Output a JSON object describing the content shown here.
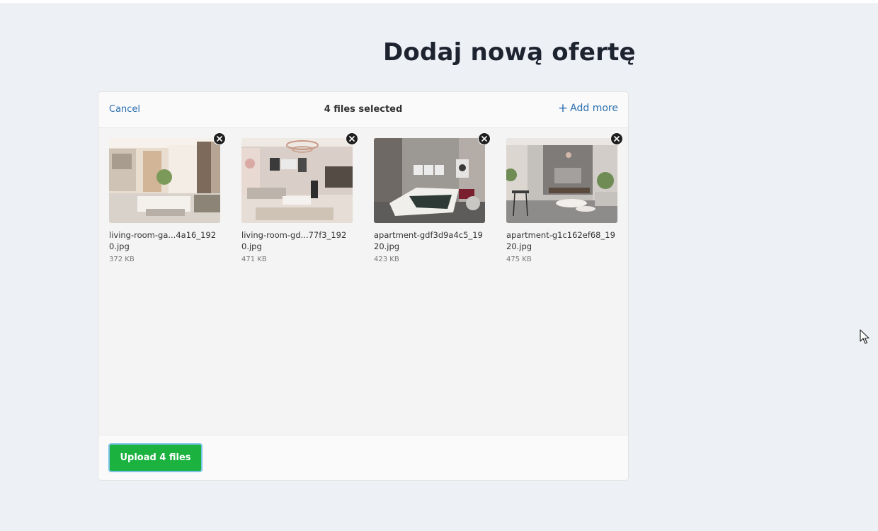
{
  "page": {
    "title": "Dodaj nową ofertę"
  },
  "dashboard": {
    "cancel_label": "Cancel",
    "status": "4 files selected",
    "add_more_icon": "+",
    "add_more_label": "Add more",
    "upload_label": "Upload 4 files",
    "files": [
      {
        "name": "living-room-ga...4a16_1920.jpg",
        "size": "372 KB"
      },
      {
        "name": "living-room-gd...77f3_1920.jpg",
        "size": "471 KB"
      },
      {
        "name": "apartment-gdf3d9a4c5_1920.jpg",
        "size": "423 KB"
      },
      {
        "name": "apartment-g1c162ef68_1920.jpg",
        "size": "475 KB"
      }
    ]
  },
  "icons": {
    "remove": "close-icon",
    "add": "plus-icon",
    "pointer": "mouse-cursor-icon"
  },
  "colors": {
    "background": "#edf0f5",
    "link": "#2b6fb0",
    "upload_button": "#1bb240",
    "upload_button_focus": "#7dc4e8"
  }
}
